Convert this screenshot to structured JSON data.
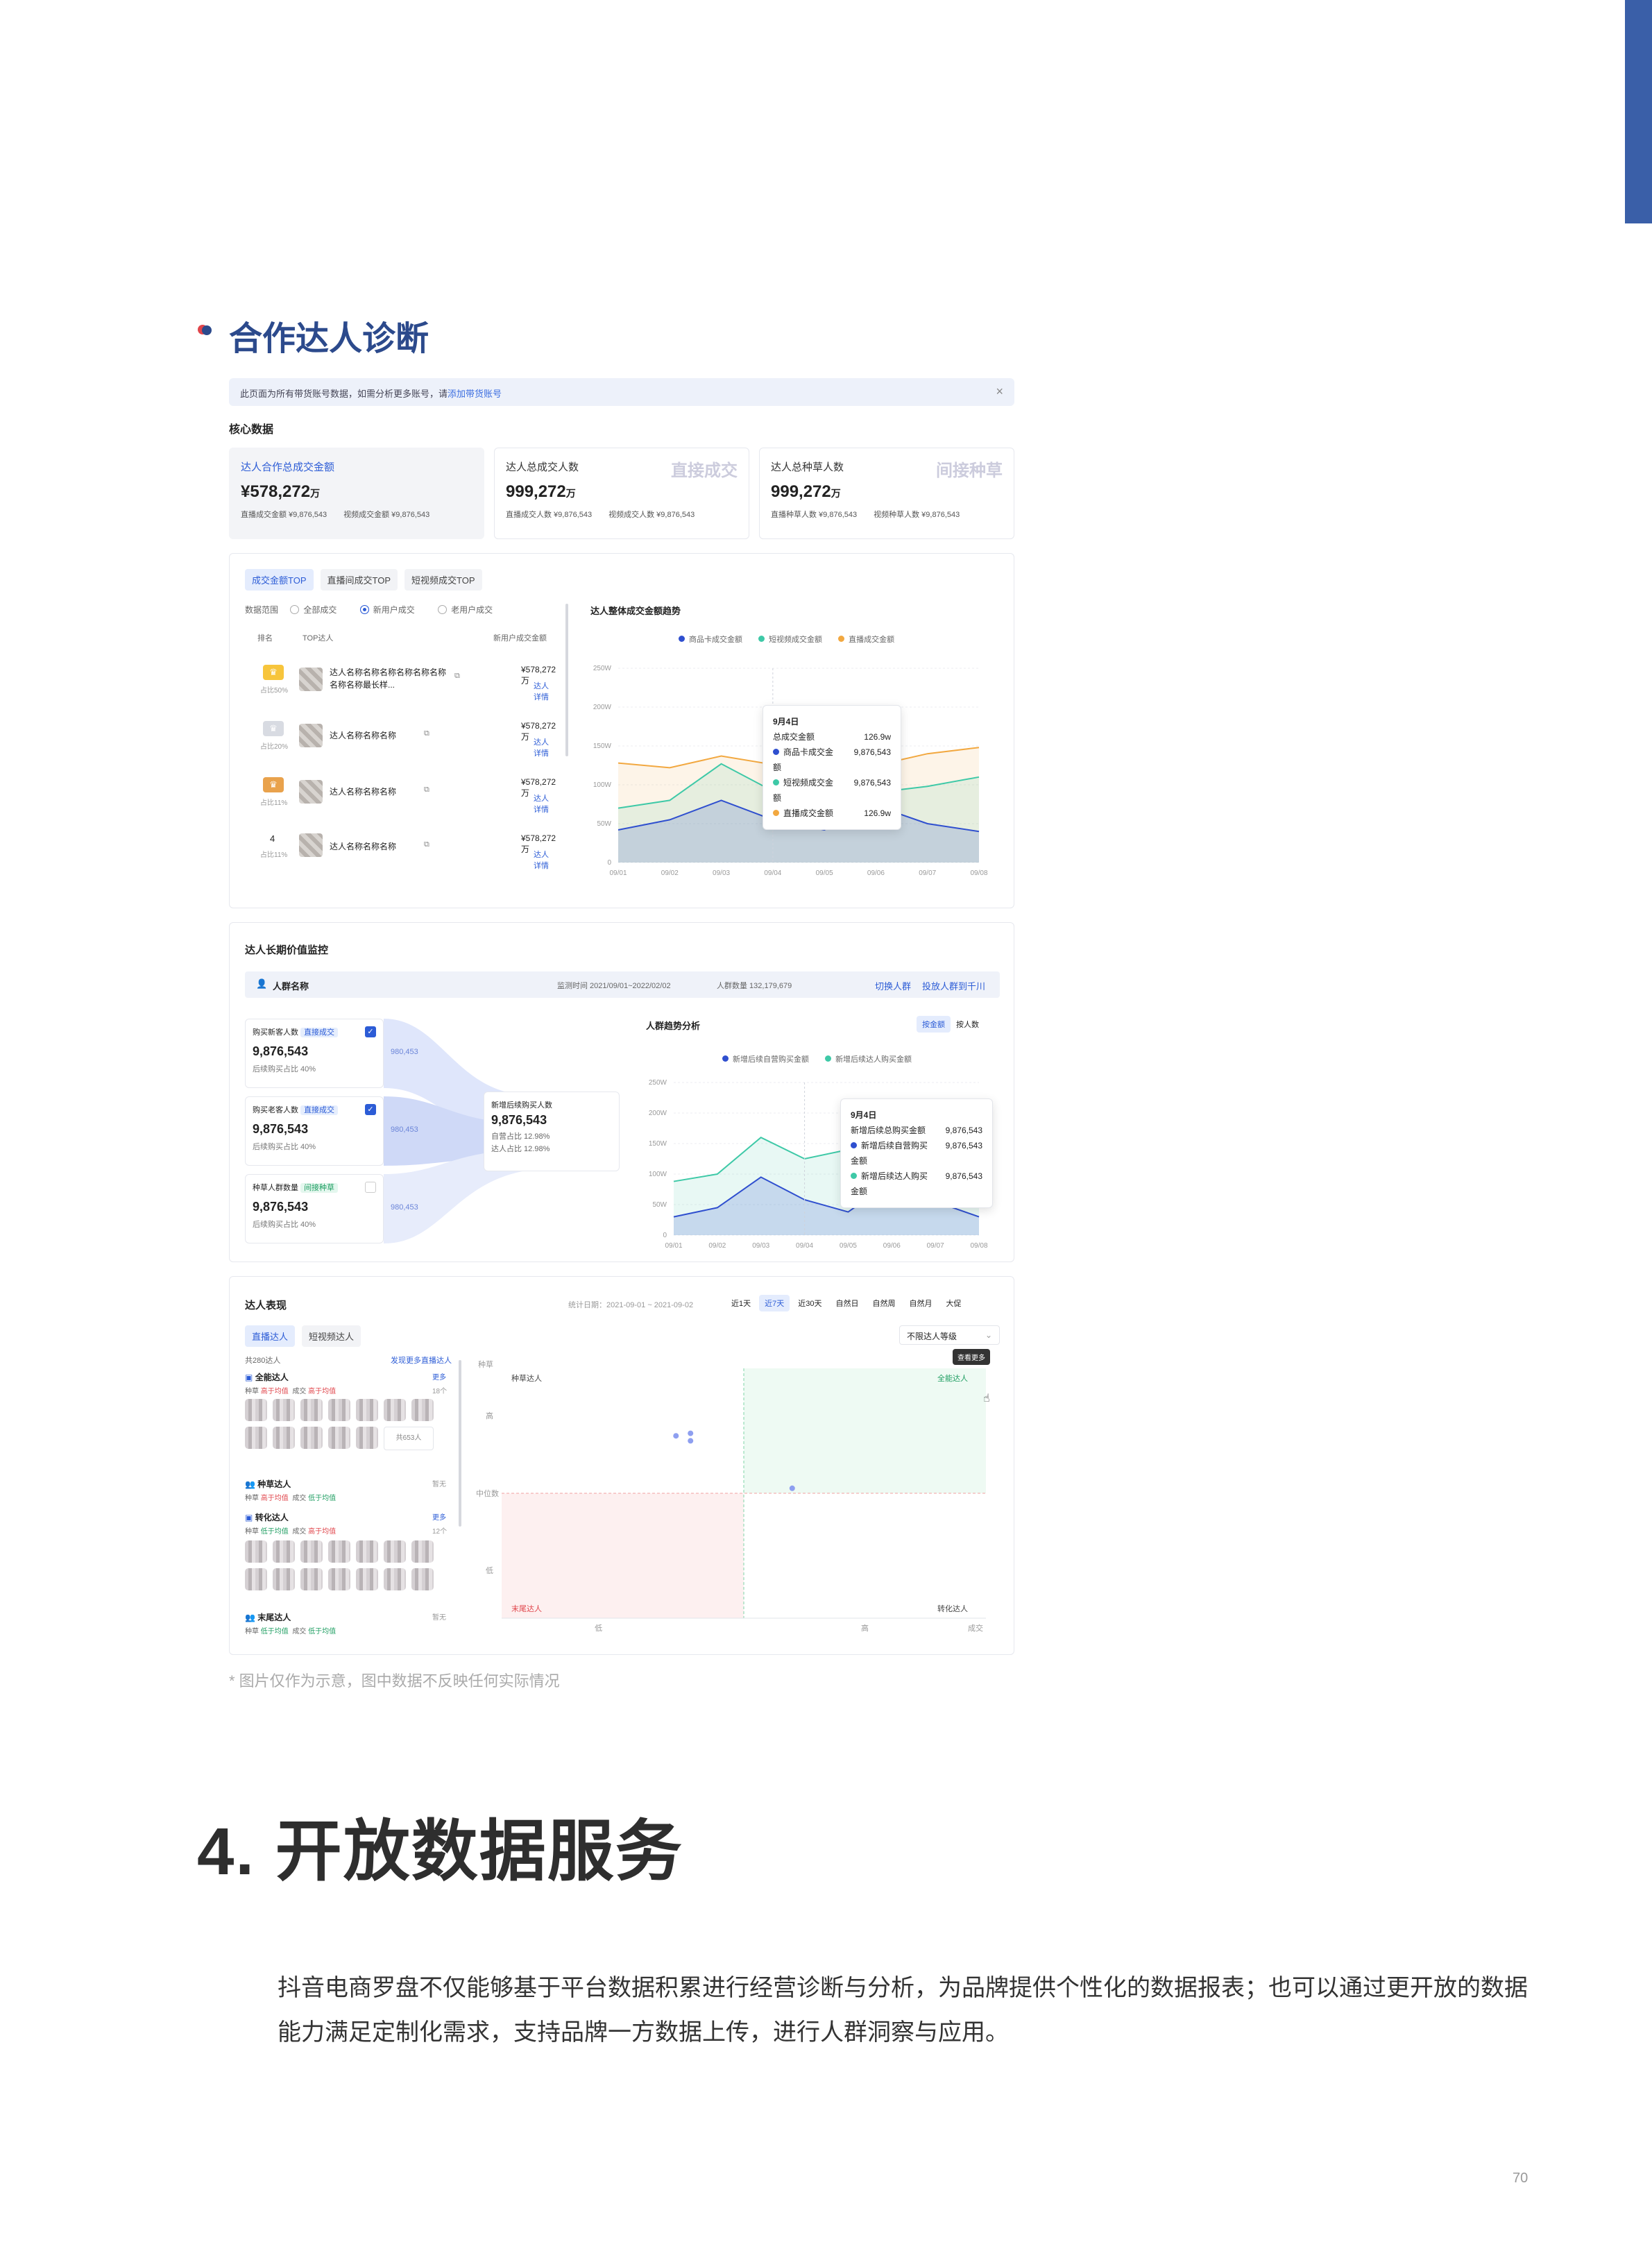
{
  "section_title": "合作达人诊断",
  "banner": {
    "text": "此页面为所有带货账号数据，如需分析更多账号，请",
    "link": "添加带货账号",
    "close": "×"
  },
  "core_label": "核心数据",
  "kpis": [
    {
      "title": "达人合作总成交金额",
      "value": "¥578,272",
      "unit": "万",
      "sub1": "直播成交金额 ¥9,876,543",
      "sub2": "视频成交金额 ¥9,876,543",
      "wm": ""
    },
    {
      "title": "达人总成交人数",
      "value": "999,272",
      "unit": "万",
      "sub1": "直播成交人数 ¥9,876,543",
      "sub2": "视频成交人数 ¥9,876,543",
      "wm": "直接成交"
    },
    {
      "title": "达人总种草人数",
      "value": "999,272",
      "unit": "万",
      "sub1": "直播种草人数 ¥9,876,543",
      "sub2": "视频种草人数 ¥9,876,543",
      "wm": "间接种草"
    }
  ],
  "top": {
    "tabs": [
      "成交金额TOP",
      "直播间成交TOP",
      "短视频成交TOP"
    ],
    "range_label": "数据范围",
    "radios": [
      "全部成交",
      "新用户成交",
      "老用户成交"
    ],
    "col_rank": "排名",
    "col_name": "TOP达人",
    "col_amt": "新用户成交金额",
    "rows": [
      {
        "rank": "1",
        "share": "占比50%",
        "name": "达人名称名称名称名称名称名称名称名称最长样...",
        "amt": "¥578,272万",
        "detail": "达人详情"
      },
      {
        "rank": "2",
        "share": "占比20%",
        "name": "达人名称名称名称",
        "amt": "¥578,272万",
        "detail": "达人详情"
      },
      {
        "rank": "3",
        "share": "占比11%",
        "name": "达人名称名称名称",
        "amt": "¥578,272万",
        "detail": "达人详情"
      },
      {
        "rank": "4",
        "share": "占比11%",
        "name": "达人名称名称名称",
        "amt": "¥578,272万",
        "detail": "达人详情"
      }
    ]
  },
  "colors": {
    "blue": "#2f4fcf",
    "teal": "#3ec9a7",
    "orange": "#f2a840",
    "brand": "#3a5fa8"
  },
  "chart_data": [
    {
      "type": "area",
      "title": "达人整体成交金额趋势",
      "categories": [
        "09/01",
        "09/02",
        "09/03",
        "09/04",
        "09/05",
        "09/06",
        "09/07",
        "09/08"
      ],
      "yticks": [
        "250W",
        "200W",
        "150W",
        "100W",
        "50W",
        "0"
      ],
      "ylim": [
        0,
        250
      ],
      "series": [
        {
          "name": "商品卡成交金额",
          "values": [
            42,
            55,
            80,
            55,
            42,
            73,
            50,
            40
          ]
        },
        {
          "name": "短视频成交金额",
          "values": [
            70,
            80,
            127,
            92,
            104,
            90,
            98,
            110
          ]
        },
        {
          "name": "直播成交金额",
          "values": [
            128,
            122,
            137,
            126,
            170,
            125,
            140,
            148
          ]
        }
      ],
      "tooltip": {
        "date": "9月4日",
        "total_label": "总成交金额",
        "total": "126.9w",
        "rows": [
          [
            "商品卡成交金额",
            "9,876,543"
          ],
          [
            "短视频成交金额",
            "9,876,543"
          ],
          [
            "直播成交金额",
            "126.9w"
          ]
        ]
      }
    },
    {
      "type": "area",
      "title": "人群趋势分析",
      "categories": [
        "09/01",
        "09/02",
        "09/03",
        "09/04",
        "09/05",
        "09/06",
        "09/07",
        "09/08"
      ],
      "yticks": [
        "250W",
        "200W",
        "150W",
        "100W",
        "50W",
        "0"
      ],
      "ylim": [
        0,
        250
      ],
      "series": [
        {
          "name": "新增后续自营购买金额",
          "values": [
            30,
            45,
            95,
            58,
            38,
            88,
            55,
            30
          ]
        },
        {
          "name": "新增后续达人购买金额",
          "values": [
            88,
            100,
            160,
            125,
            140,
            128,
            118,
            128
          ]
        }
      ],
      "tooltip": {
        "date": "9月4日",
        "total_label": "新增后续总购买金额",
        "total": "9,876,543",
        "rows": [
          [
            "新增后续自营购买金额",
            "9,876,543"
          ],
          [
            "新增后续达人购买金额",
            "9,876,543"
          ]
        ]
      }
    },
    {
      "type": "scatter",
      "xlabel": "成交",
      "ylabel": "种草",
      "xticks": [
        "低",
        "高"
      ],
      "yticks": [
        "高",
        "中位数",
        "低"
      ],
      "quadrants": [
        "种草达人",
        "全能达人",
        "末尾达人",
        "转化达人"
      ],
      "points": [
        [
          0.36,
          0.73
        ],
        [
          0.39,
          0.74
        ],
        [
          0.39,
          0.71
        ],
        [
          0.6,
          0.52
        ]
      ]
    }
  ],
  "monitor": {
    "title": "达人长期价值监控",
    "crowd_name": "人群名称",
    "period": "监测时间 2021/09/01~2022/02/02",
    "count": "人群数量 132,179,679",
    "switch": "切换人群",
    "push": "投放人群到千川",
    "boxes": [
      {
        "title": "购买新客人数",
        "tag": "直接成交",
        "value": "9,876,543",
        "sub": "后续购买占比 40%",
        "flow": "980,453"
      },
      {
        "title": "购买老客人数",
        "tag": "直接成交",
        "value": "9,876,543",
        "sub": "后续购买占比 40%",
        "flow": "980,453"
      },
      {
        "title": "种草人群数量",
        "tag": "间接种草",
        "value": "9,876,543",
        "sub": "后续购买占比 40%",
        "flow": "980,453"
      }
    ],
    "merge": {
      "title": "新增后续购买人数",
      "value": "9,876,543",
      "l1": "自营占比 12.98%",
      "l2": "达人占比 12.98%"
    },
    "toggle": [
      "按金额",
      "按人数"
    ]
  },
  "perf": {
    "title": "达人表现",
    "date": "统计日期：2021-09-01 ~ 2021-09-02",
    "ranges": [
      "近1天",
      "近7天",
      "近30天",
      "自然日",
      "自然周",
      "自然月",
      "大促"
    ],
    "tabs": [
      "直播达人",
      "短视频达人"
    ],
    "select": "不限达人等级",
    "tooltip": "查看更多",
    "count": "共280达人",
    "discover": "发现更多直播达人",
    "groups": [
      {
        "name": "全能达人",
        "more": "更多",
        "desc_a": "种草",
        "va": "高于均值",
        "desc_b": "成交",
        "vb": "高于均值",
        "cnt": "18个"
      },
      {
        "name": "种草达人",
        "more": "暂无",
        "desc_a": "种草",
        "va": "高于均值",
        "desc_b": "成交",
        "vb": "低于均值",
        "cnt": ""
      },
      {
        "name": "转化达人",
        "more": "更多",
        "desc_a": "种草",
        "va": "低于均值",
        "desc_b": "成交",
        "vb": "高于均值",
        "cnt": "12个"
      },
      {
        "name": "末尾达人",
        "more": "暂无",
        "desc_a": "种草",
        "va": "低于均值",
        "desc_b": "成交",
        "vb": "低于均值",
        "cnt": ""
      }
    ],
    "total_people": "共653人"
  },
  "caption": "* 图片仅作为示意，图中数据不反映任何实际情况",
  "heading": "4. 开放数据服务",
  "paragraph": "抖音电商罗盘不仅能够基于平台数据积累进行经营诊断与分析，为品牌提供个性化的数据报表；也可以通过更开放的数据能力满足定制化需求，支持品牌一方数据上传，进行人群洞察与应用。",
  "page_number": "70"
}
